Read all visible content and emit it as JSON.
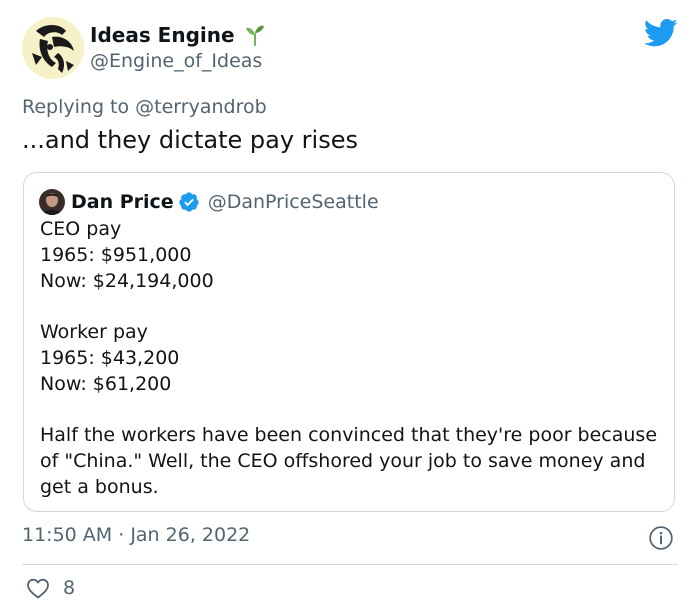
{
  "author": {
    "display_name": "Ideas Engine",
    "handle": "@Engine_of_Ideas",
    "badge_icon": "sprout-icon",
    "avatar_bg": "#f6f1c8"
  },
  "brand": {
    "icon": "twitter-bird-icon",
    "color": "#1d9bf0"
  },
  "reply": {
    "prefix": "Replying to ",
    "mention": "@terryandrob"
  },
  "tweet_text": "...and they dictate pay rises",
  "quoted": {
    "display_name": "Dan Price",
    "handle": "@DanPriceSeattle",
    "verified_icon": "verified-badge-icon",
    "lines": [
      "CEO pay",
      "1965: $951,000",
      "Now: $24,194,000",
      "",
      "Worker pay",
      "1965: $43,200",
      "Now: $61,200",
      "",
      "Half the workers have been convinced that they're poor because",
      "of \"China.\" Well, the CEO offshored your job to save money and",
      "get a bonus."
    ]
  },
  "meta": {
    "time": "11:50 AM",
    "separator": " · ",
    "date": "Jan 26, 2022"
  },
  "engagement": {
    "likes": "8",
    "like_icon": "heart-icon"
  },
  "info_icon": "info-icon"
}
